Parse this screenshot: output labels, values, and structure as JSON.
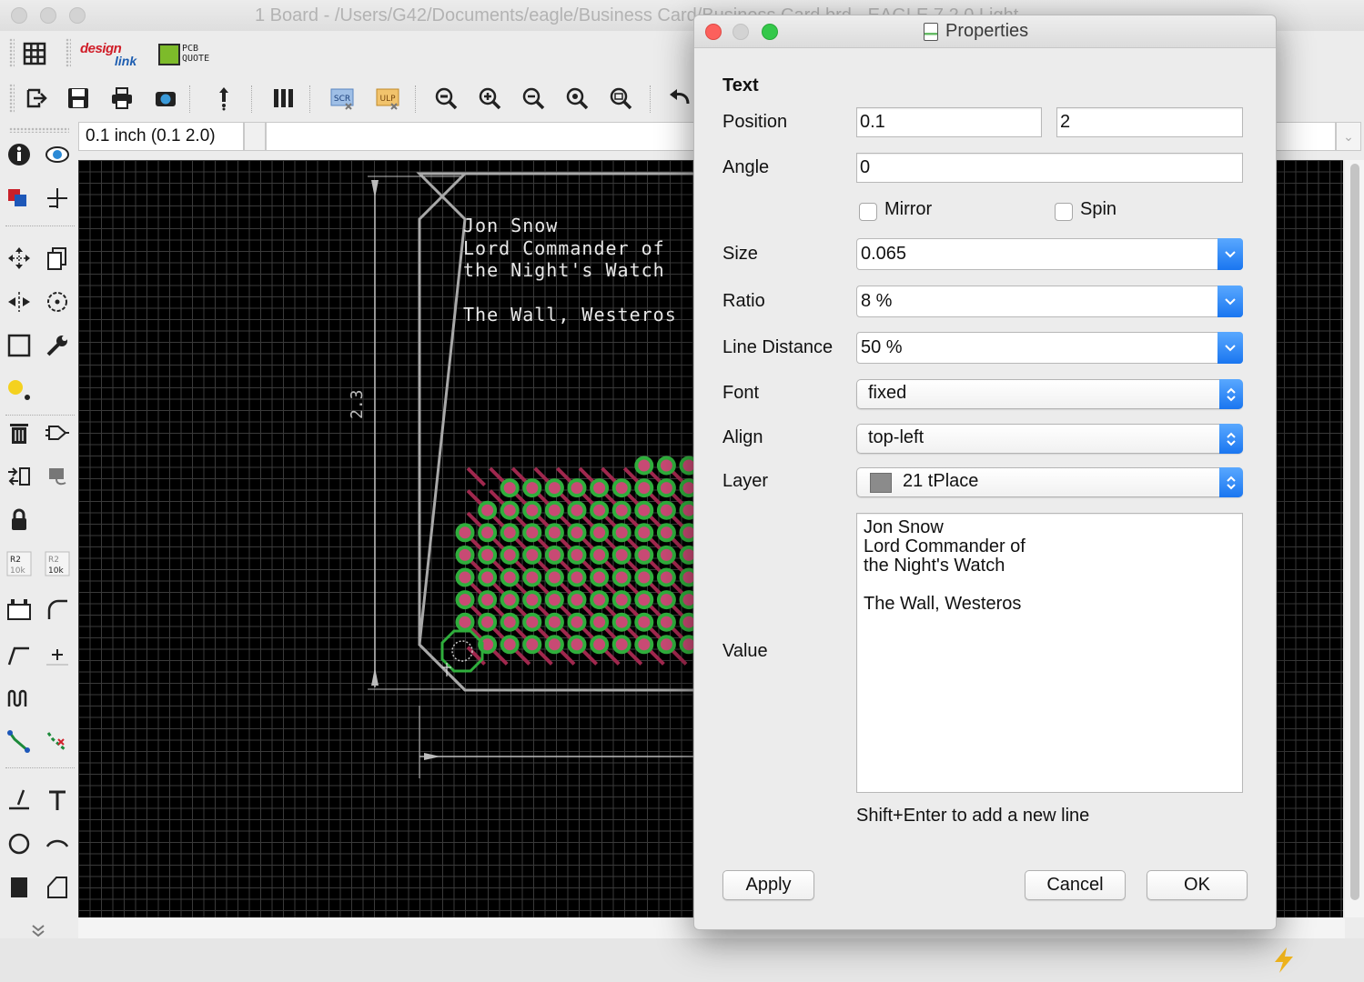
{
  "main_window": {
    "title": "1 Board - /Users/G42/Documents/eagle/Business Card/Business Card.brd - EAGLE 7.2.0 Light"
  },
  "toolbar": {
    "design_link": [
      "design",
      "link"
    ],
    "pcb_quote": [
      "PCB",
      "QUOTE"
    ],
    "icons": [
      "grid-icon",
      "open-icon",
      "save-icon",
      "print-icon",
      "cam-icon",
      "ulp-upload-icon",
      "layer-settings-icon",
      "script-icon",
      "ulp-icon",
      "zoom-fit-icon",
      "zoom-in-icon",
      "zoom-out-icon",
      "zoom-redraw-icon",
      "zoom-select-icon",
      "undo-icon"
    ],
    "script_label": "SCR",
    "ulp_label": "ULP"
  },
  "coordinates": "0.1 inch (0.1 2.0)",
  "board": {
    "text_lines": [
      "Jon Snow",
      "Lord Commander of",
      "the Night's Watch",
      "",
      "The Wall, Westeros"
    ],
    "dimension_label": "2.3"
  },
  "properties": {
    "title": "Properties",
    "section": "Text",
    "position_label": "Position",
    "position_x": "0.1",
    "position_y": "2",
    "angle_label": "Angle",
    "angle": "0",
    "mirror_label": "Mirror",
    "mirror_checked": false,
    "spin_label": "Spin",
    "spin_checked": false,
    "size_label": "Size",
    "size": "0.065",
    "ratio_label": "Ratio",
    "ratio": "8 %",
    "line_distance_label": "Line Distance",
    "line_distance": "50 %",
    "font_label": "Font",
    "font": "fixed",
    "align_label": "Align",
    "align": "top-left",
    "layer_label": "Layer",
    "layer": "21 tPlace",
    "layer_color": "#8b8b8b",
    "value_label": "Value",
    "value": "Jon Snow\nLord Commander of\nthe Night's Watch\n\nThe Wall, Westeros",
    "hint": "Shift+Enter to add a new line",
    "apply_label": "Apply",
    "cancel_label": "Cancel",
    "ok_label": "OK"
  },
  "colors": {
    "accent_blue": "#1a76f0",
    "close_red": "#fc605c",
    "zoom_green": "#34c84a",
    "pad_green": "#2fae3c",
    "trace_red": "#a0284e",
    "board_outline": "#a8a8a8"
  }
}
